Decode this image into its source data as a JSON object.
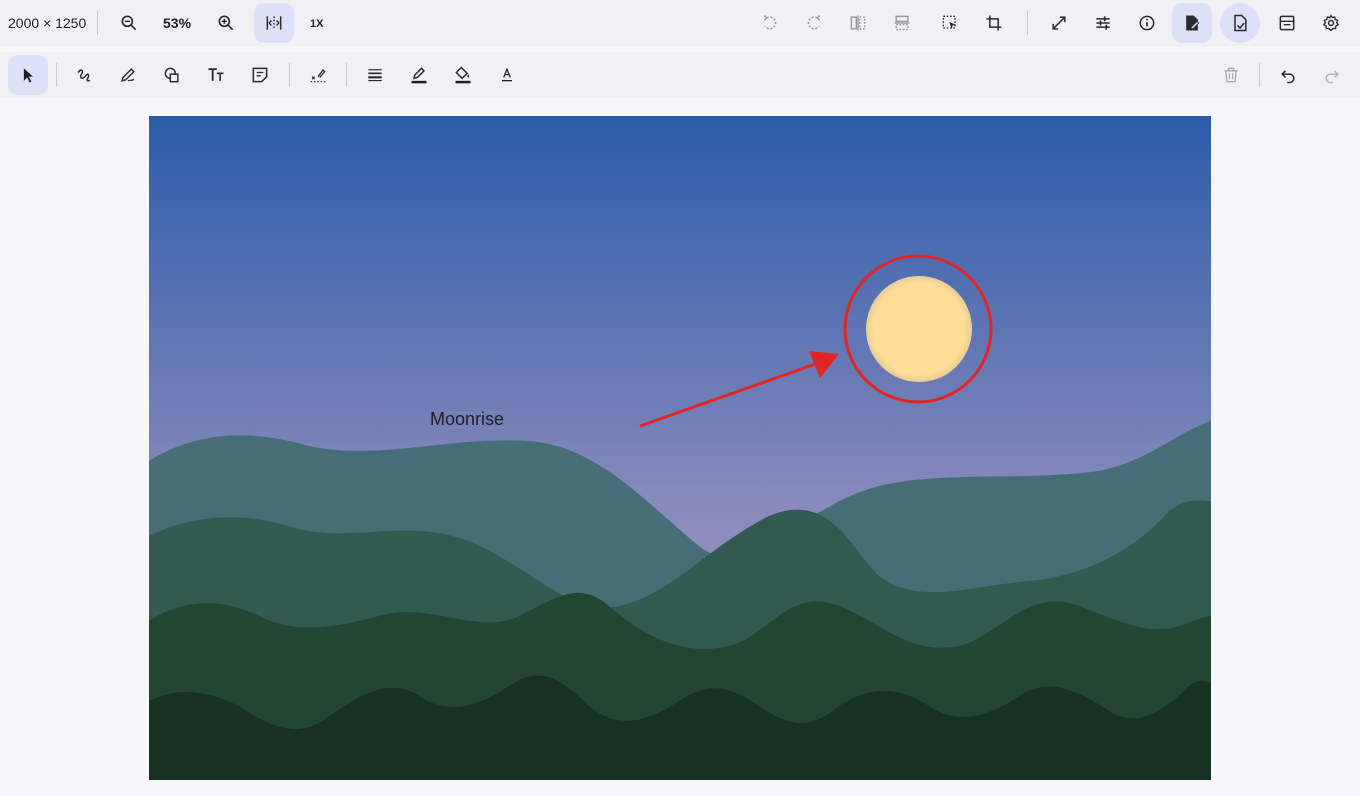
{
  "header": {
    "image_size": "2000 × 1250",
    "zoom": "53%",
    "scale_label": "1X"
  },
  "icons": {
    "zoom_out": "zoom-out-icon",
    "zoom_in": "zoom-in-icon",
    "fit": "fit-width-icon",
    "rotate_left": "rotate-left-icon",
    "rotate_right": "rotate-right-icon",
    "flip_h": "flip-horizontal-icon",
    "flip_v": "flip-vertical-icon",
    "select_region": "select-region-icon",
    "crop": "crop-icon",
    "resize": "resize-icon",
    "adjust": "adjust-icon",
    "info": "info-icon",
    "annotate": "annotate-icon",
    "save_file": "save-file-icon",
    "save": "save-icon",
    "settings": "settings-icon",
    "select_tool": "select-tool-icon",
    "freehand": "freehand-icon",
    "pen": "pen-icon",
    "shapes": "shapes-icon",
    "text": "text-icon",
    "note": "note-icon",
    "signature": "signature-icon",
    "line_weight": "line-weight-icon",
    "stroke_color": "stroke-color-icon",
    "fill_color": "fill-color-icon",
    "font_color": "font-color-icon",
    "delete": "delete-icon",
    "undo": "undo-icon",
    "redo": "redo-icon"
  },
  "colors": {
    "sky_top": "#2b5ca9",
    "sky_bottom": "#ab9ec8",
    "moon": "#ffdf97",
    "annotation": "#e02525"
  },
  "canvas": {
    "annotation_text": "Moonrise"
  }
}
